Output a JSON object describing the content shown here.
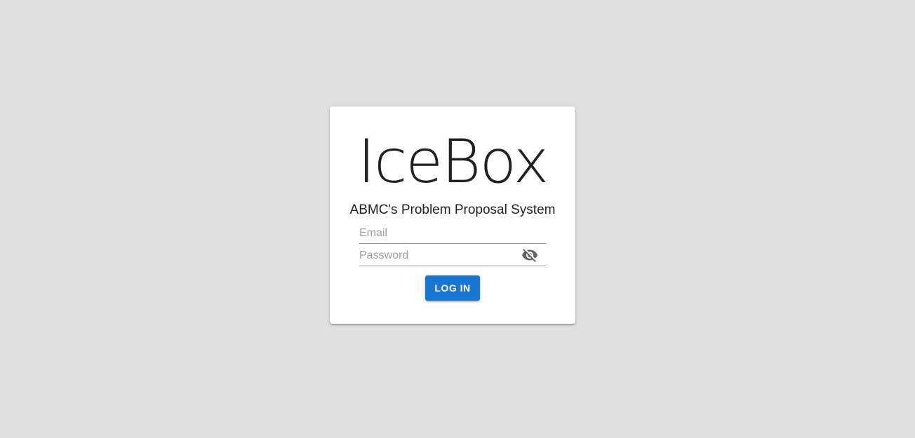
{
  "login": {
    "brand": "IceBox",
    "subtitle": "ABMC's Problem Proposal System",
    "email": {
      "placeholder": "Email",
      "value": ""
    },
    "password": {
      "placeholder": "Password",
      "value": "",
      "visibility_icon": "visibility-off-icon"
    },
    "login_button": "LOG IN"
  },
  "colors": {
    "background": "#e0e0e0",
    "card": "#ffffff",
    "primary": "#1976d2",
    "text": "#212121",
    "placeholder": "#9e9e9e"
  }
}
